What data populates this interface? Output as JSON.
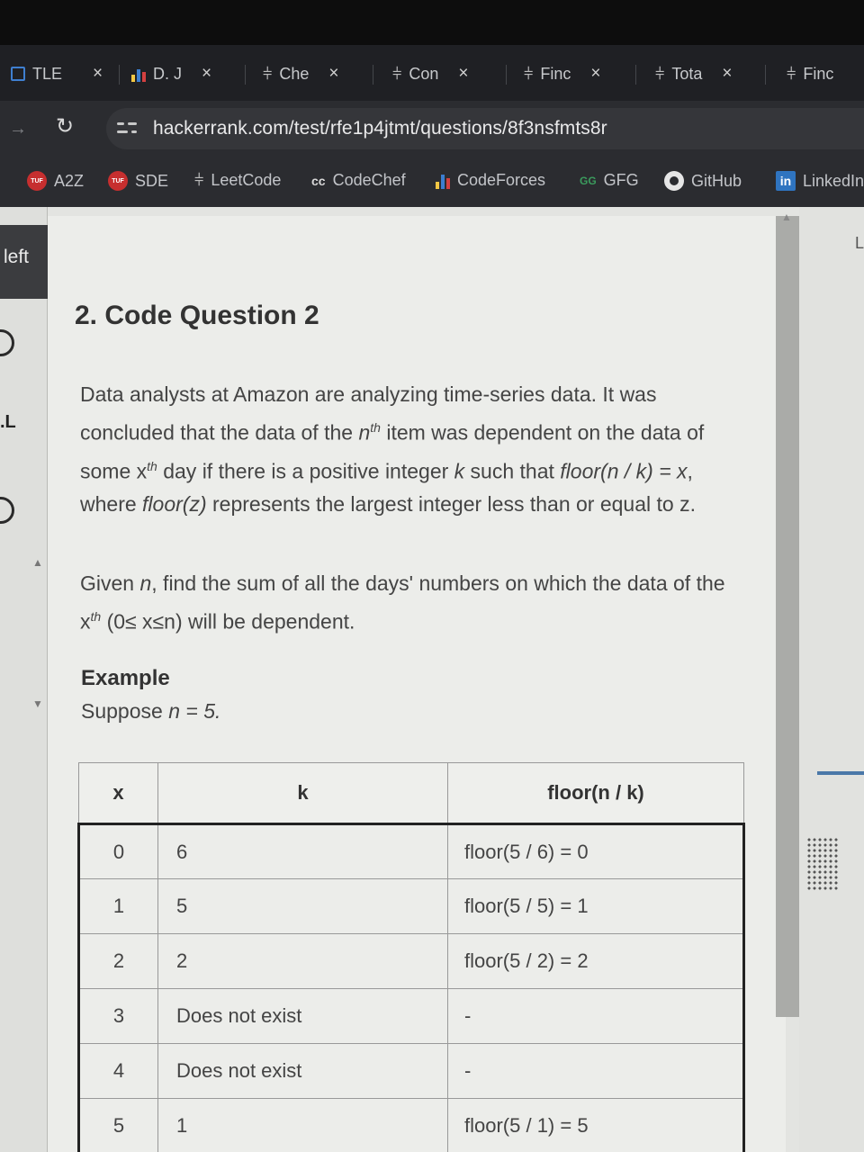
{
  "tabs": [
    {
      "label": "TLE",
      "favicon": "tle-icon"
    },
    {
      "label": "D. J",
      "favicon": "codeforces-icon"
    },
    {
      "label": "Che",
      "favicon": "leetcode-icon"
    },
    {
      "label": "Con",
      "favicon": "leetcode-icon"
    },
    {
      "label": "Finc",
      "favicon": "leetcode-icon"
    },
    {
      "label": "Tota",
      "favicon": "leetcode-icon"
    },
    {
      "label": "Finc",
      "favicon": "leetcode-icon"
    }
  ],
  "close_glyph": "×",
  "url": "hackerrank.com/test/rfe1p4jtmt/questions/8f3nsfmts8r",
  "bookmarks": [
    {
      "label": "A2Z",
      "icon": "tuf-icon",
      "icon_text": "TUF"
    },
    {
      "label": "SDE",
      "icon": "tuf-icon",
      "icon_text": "TUF"
    },
    {
      "label": "LeetCode",
      "icon": "leetcode-icon"
    },
    {
      "label": "CodeChef",
      "icon": "codechef-icon",
      "icon_text": "cc"
    },
    {
      "label": "CodeForces",
      "icon": "codeforces-icon"
    },
    {
      "label": "GFG",
      "icon": "gfg-icon",
      "icon_text": "GG"
    },
    {
      "label": "GitHub",
      "icon": "github-icon"
    },
    {
      "label": "LinkedIn",
      "icon": "linkedin-icon",
      "icon_text": "in"
    }
  ],
  "left_panel": {
    "label": "left"
  },
  "question": {
    "title": "2. Code Question 2",
    "p1": {
      "a": "Data analysts at Amazon are analyzing time-series data. It was concluded that the data of the ",
      "n": "n",
      "th1": "th",
      "b": " item was dependent on the data of some x",
      "th2": "th",
      "c": " day if there is a positive integer ",
      "k": "k",
      "d": " such that ",
      "floor_expr": "floor(n / k) = x",
      "e": ", where ",
      "floor_z": "floor(z)",
      "f": " represents the largest integer less than or equal to z."
    },
    "p2": {
      "a": "Given ",
      "n": "n",
      "b": ", find the sum of all the days' numbers on which the data of the x",
      "th": "th",
      "c": " (0≤ x≤n) will be dependent."
    },
    "example_heading": "Example",
    "example_intro_a": "Suppose ",
    "example_intro_b": "n = 5."
  },
  "table": {
    "headers": [
      "x",
      "k",
      "floor(n / k)"
    ],
    "rows": [
      [
        "0",
        "6",
        "floor(5 / 6) = 0"
      ],
      [
        "1",
        "5",
        "floor(5 / 5) = 1"
      ],
      [
        "2",
        "2",
        "floor(5 / 2) = 2"
      ],
      [
        "3",
        "Does not exist",
        "-"
      ],
      [
        "4",
        "Does not exist",
        "-"
      ],
      [
        "5",
        "1",
        "floor(5 / 1) = 5"
      ]
    ]
  }
}
